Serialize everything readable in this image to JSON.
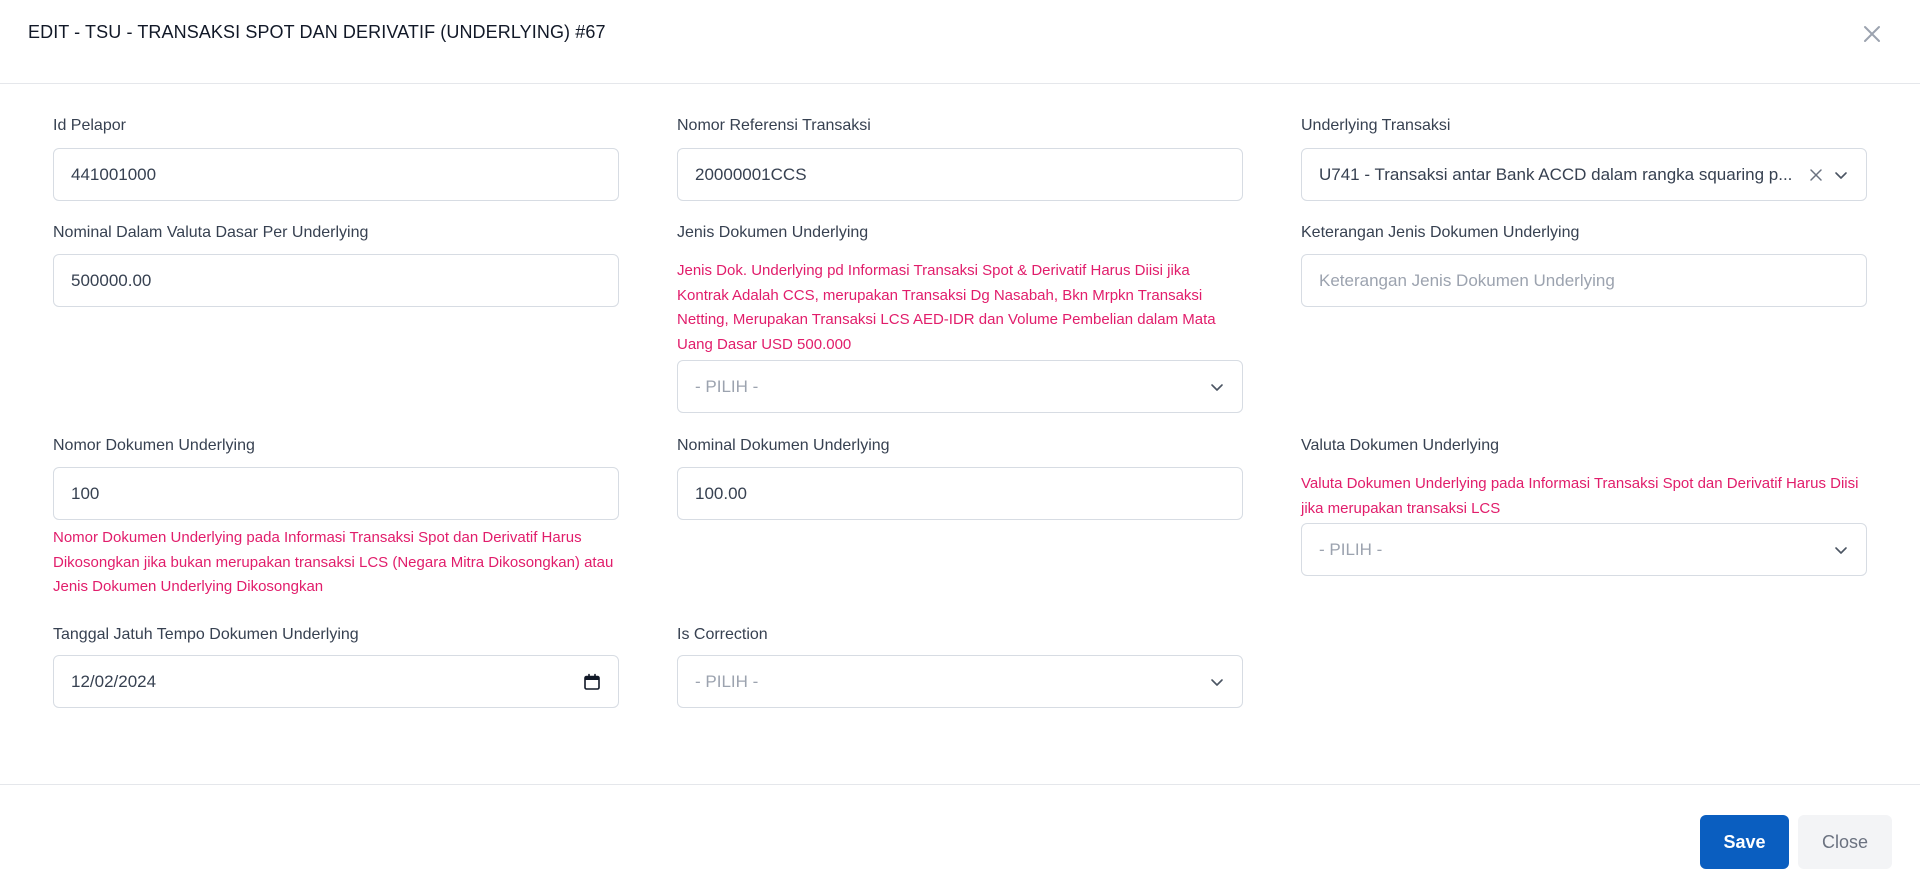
{
  "modal": {
    "title": "EDIT - TSU - TRANSAKSI SPOT DAN DERIVATIF (UNDERLYING) #67",
    "close_icon": "close-icon"
  },
  "fields": {
    "id_pelapor": {
      "label": "Id Pelapor",
      "value": "441001000"
    },
    "nomor_referensi": {
      "label": "Nomor Referensi Transaksi",
      "value": "20000001CCS"
    },
    "underlying_transaksi": {
      "label": "Underlying Transaksi",
      "value": "U741 - Transaksi antar Bank ACCD dalam rangka squaring p..."
    },
    "nominal_valuta_dasar": {
      "label": "Nominal Dalam Valuta Dasar Per Underlying",
      "value": "500000.00"
    },
    "jenis_dokumen": {
      "label": "Jenis Dokumen Underlying",
      "error": "Jenis Dok. Underlying pd Informasi Transaksi Spot & Derivatif Harus Diisi jika Kontrak Adalah CCS, merupakan Transaksi Dg Nasabah, Bkn Mrpkn Transaksi Netting, Merupakan Transaksi LCS AED-IDR dan Volume Pembelian dalam Mata Uang Dasar USD 500.000",
      "value": "- PILIH -"
    },
    "keterangan_jenis_dokumen": {
      "label": "Keterangan Jenis Dokumen Underlying",
      "placeholder": "Keterangan Jenis Dokumen Underlying"
    },
    "nomor_dokumen": {
      "label": "Nomor Dokumen Underlying",
      "value": "100",
      "error": "Nomor Dokumen Underlying pada Informasi Transaksi Spot dan Derivatif Harus Dikosongkan jika bukan merupakan transaksi LCS (Negara Mitra Dikosongkan) atau Jenis Dokumen Underlying Dikosongkan"
    },
    "nominal_dokumen": {
      "label": "Nominal Dokumen Underlying",
      "value": "100.00"
    },
    "valuta_dokumen": {
      "label": "Valuta Dokumen Underlying",
      "error": "Valuta Dokumen Underlying pada Informasi Transaksi Spot dan Derivatif Harus Diisi jika merupakan transaksi LCS",
      "value": "- PILIH -"
    },
    "tanggal_jatuh_tempo": {
      "label": "Tanggal Jatuh Tempo Dokumen Underlying",
      "value": "12/02/2024"
    },
    "is_correction": {
      "label": "Is Correction",
      "value": "- PILIH -"
    }
  },
  "footer": {
    "save_label": "Save",
    "close_label": "Close"
  },
  "colors": {
    "primary": "#0a5ec0",
    "error": "#e11d6b",
    "border": "#d7dce3"
  }
}
